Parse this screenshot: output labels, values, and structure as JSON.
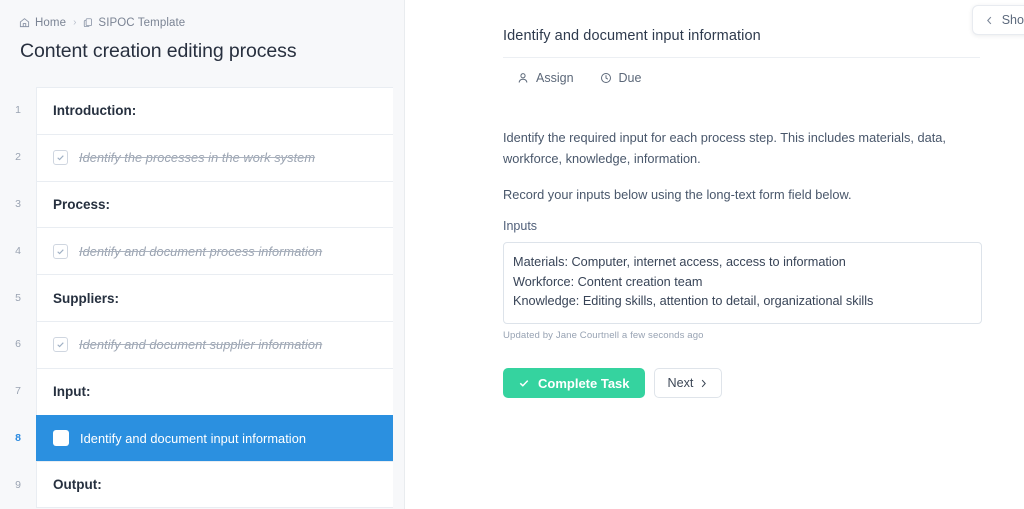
{
  "breadcrumb": {
    "home_label": "Home",
    "separator": "›",
    "template_label": "SIPOC Template",
    "home_icon": "home-icon",
    "template_icon": "copy-icon"
  },
  "page_title": "Content creation editing process",
  "checklist": {
    "rows": [
      {
        "number": "1",
        "type": "heading",
        "label": "Introduction:",
        "checked": false,
        "selected": false
      },
      {
        "number": "2",
        "type": "task",
        "label": "Identify the processes in the work system",
        "checked": true,
        "selected": false
      },
      {
        "number": "3",
        "type": "heading",
        "label": "Process:",
        "checked": false,
        "selected": false
      },
      {
        "number": "4",
        "type": "task",
        "label": "Identify and document process information",
        "checked": true,
        "selected": false
      },
      {
        "number": "5",
        "type": "heading",
        "label": "Suppliers:",
        "checked": false,
        "selected": false
      },
      {
        "number": "6",
        "type": "task",
        "label": "Identify and document supplier information",
        "checked": true,
        "selected": false
      },
      {
        "number": "7",
        "type": "heading",
        "label": "Input:",
        "checked": false,
        "selected": false
      },
      {
        "number": "8",
        "type": "task",
        "label": "Identify and document input information",
        "checked": false,
        "selected": true
      },
      {
        "number": "9",
        "type": "heading",
        "label": "Output:",
        "checked": false,
        "selected": false
      }
    ]
  },
  "task": {
    "title": "Identify and document input information",
    "assign_label": "Assign",
    "assign_icon": "person-icon",
    "due_label": "Due",
    "due_icon": "clock-icon",
    "description_paragraphs": [
      "Identify the required input for each process step. This includes materials, data, workforce, knowledge, information.",
      "Record your inputs below using the long-text form field below."
    ],
    "field": {
      "label": "Inputs",
      "lines": [
        "Materials: Computer, internet access, access to information",
        "Workforce: Content creation team",
        "Knowledge: Editing skills, attention to detail, organizational skills"
      ],
      "updated_note": "Updated by Jane Courtnell a few seconds ago"
    },
    "complete_button": "Complete Task",
    "complete_icon": "check-icon",
    "next_button": "Next",
    "next_icon": "chevron-right-icon"
  },
  "show_pill": {
    "label": "Show",
    "icon": "chevron-left-icon"
  },
  "colors": {
    "selected_row": "#2b90e0",
    "complete_button": "#35d39f",
    "panel_background": "#f7f8fa",
    "active_number": "#2b8ae0"
  }
}
